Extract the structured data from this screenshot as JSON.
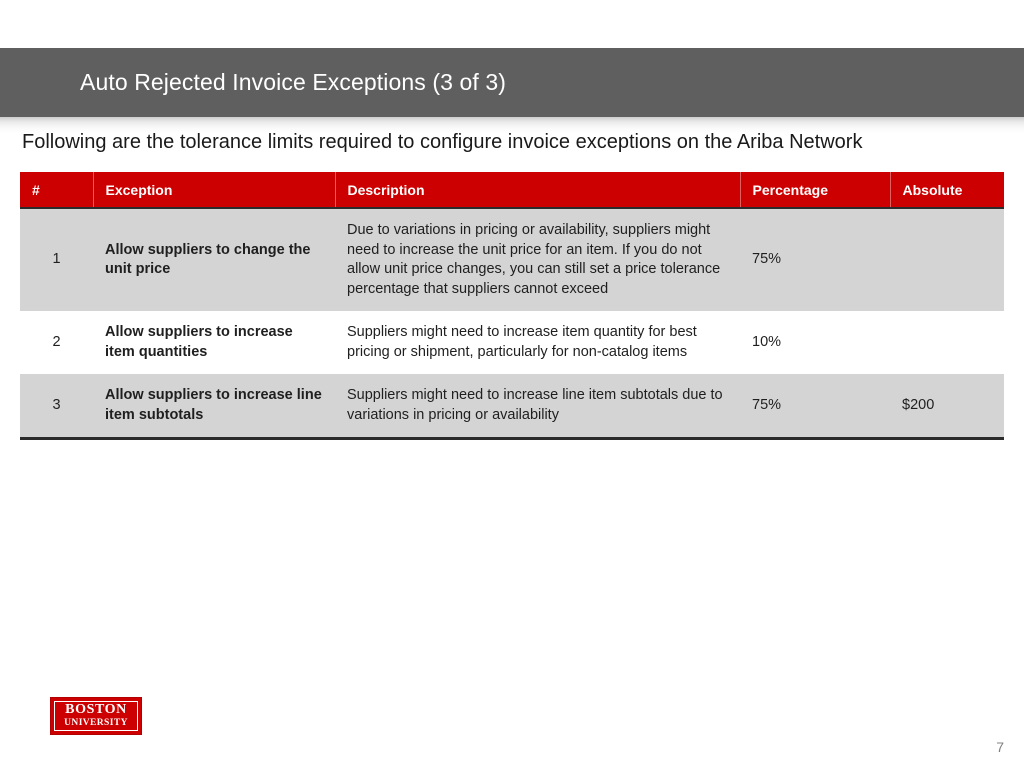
{
  "slide": {
    "title": "Auto Rejected Invoice Exceptions (3 of 3)",
    "subtitle": "Following are the tolerance limits required to configure invoice exceptions on the Ariba Network",
    "page_number": "7",
    "colors": {
      "title_bar": "#5F5F5F",
      "table_header_red": "#CC0000",
      "shaded_row": "#D4D4D4",
      "text": "#1F1F1F"
    }
  },
  "table": {
    "headers": {
      "number": "#",
      "exception": "Exception",
      "description": "Description",
      "percentage": "Percentage",
      "absolute": "Absolute"
    },
    "rows": [
      {
        "number": "1",
        "exception": "Allow suppliers to change the unit price",
        "description": "Due to variations in pricing or availability, suppliers might need to increase the unit price for an item. If you do not allow unit price changes, you can still set a price tolerance percentage that suppliers cannot exceed",
        "percentage": "75%",
        "absolute": ""
      },
      {
        "number": "2",
        "exception": "Allow suppliers to increase item quantities",
        "description": "Suppliers might need to increase item quantity for best pricing or shipment, particularly for non-catalog items",
        "percentage": "10%",
        "absolute": ""
      },
      {
        "number": "3",
        "exception": "Allow suppliers to increase line item subtotals",
        "description": "Suppliers might need to increase line item subtotals due to variations in pricing or availability",
        "percentage": "75%",
        "absolute": "$200"
      }
    ]
  },
  "logo": {
    "line1": "BOSTON",
    "line2": "UNIVERSITY"
  }
}
